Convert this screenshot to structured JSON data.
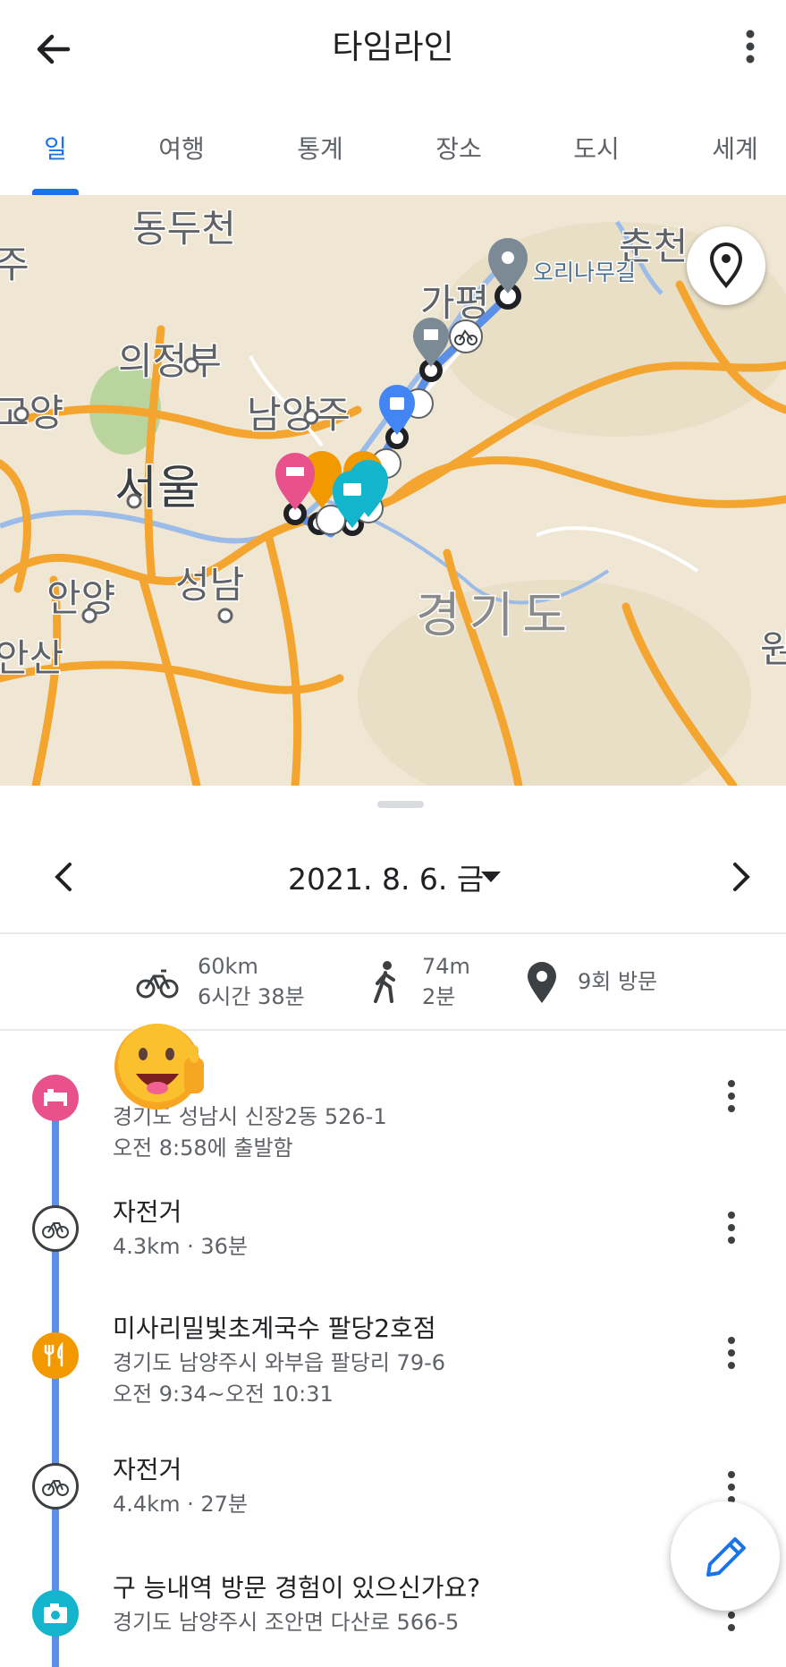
{
  "appbar": {
    "title": "타임라인"
  },
  "tabs": [
    {
      "label": "일",
      "active": true
    },
    {
      "label": "여행",
      "active": false
    },
    {
      "label": "통계",
      "active": false
    },
    {
      "label": "장소",
      "active": false
    },
    {
      "label": "도시",
      "active": false
    },
    {
      "label": "세계",
      "active": false
    }
  ],
  "map": {
    "labels": {
      "dongducheon": "동두천",
      "chuncheon": "춘천",
      "ju": "주",
      "gapyeong": "가평",
      "orinamu": "오리나무길",
      "uijeongbu": "의정부",
      "namyangju": "남양주",
      "goyang": "고양",
      "seoul": "서울",
      "anyang": "안양",
      "seongnam": "성남",
      "gyeonggido": "경기도",
      "ansan": "안산",
      "won": "원"
    }
  },
  "date_nav": {
    "date": "2021. 8. 6. 금"
  },
  "summary": {
    "cycling": {
      "distance": "60km",
      "duration": "6시간 38분"
    },
    "walking": {
      "distance": "74m",
      "duration": "2분"
    },
    "visits": "9회 방문"
  },
  "timeline": [
    {
      "type": "hotel",
      "title": "",
      "line1": "경기도 성남시 신장2동 526-1",
      "line2": "오전 8:58에 출발함"
    },
    {
      "type": "cycle",
      "title": "자전거",
      "line1": "4.3km · 36분"
    },
    {
      "type": "food",
      "title": "미사리밀빛초계국수 팔당2호점",
      "line1": "경기도 남양주시 와부읍 팔당리 79-6",
      "line2": "오전 9:34~오전 10:31"
    },
    {
      "type": "cycle",
      "title": "자전거",
      "line1": "4.4km · 27분"
    },
    {
      "type": "photo",
      "title": "구 능내역 방문 경험이 있으신가요?",
      "line1": "경기도 남양주시 조안면 다산로 566-5"
    }
  ],
  "colors": {
    "accent": "#1a73e8",
    "hotel": "#e8518b",
    "food": "#f29900",
    "photo": "#12b5cb",
    "shopping": "#4285f4",
    "route": "#5c8fe6"
  }
}
